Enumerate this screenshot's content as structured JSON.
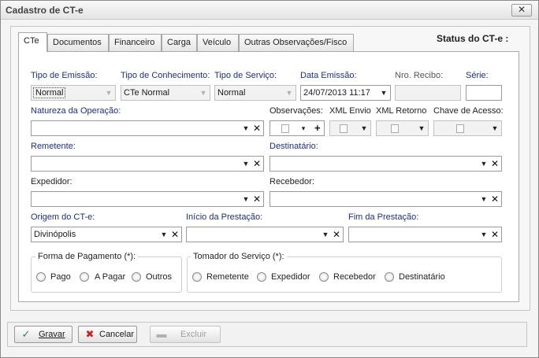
{
  "window": {
    "title": "Cadastro de CT-e"
  },
  "tabs": [
    "CTe",
    "Documentos",
    "Financeiro",
    "Carga",
    "Veículo",
    "Outras Observações/Fisco"
  ],
  "status": {
    "label": "Status do CT-e :"
  },
  "form": {
    "tipo_emissao": {
      "label": "Tipo de Emissão:",
      "value": "Normal"
    },
    "tipo_conhecimento": {
      "label": "Tipo de Conhecimento:",
      "value": "CTe Normal"
    },
    "tipo_servico": {
      "label": "Tipo de Serviço:",
      "value": "Normal"
    },
    "data_emissao": {
      "label": "Data Emissão:",
      "value": "24/07/2013 11:17"
    },
    "nro_recibo": {
      "label": "Nro. Recibo:",
      "value": ""
    },
    "serie": {
      "label": "Série:",
      "value": ""
    },
    "natureza": {
      "label": "Natureza da Operação:",
      "value": ""
    },
    "observacoes": {
      "label": "Observações:"
    },
    "xml_envio": {
      "label": "XML Envio"
    },
    "xml_retorno": {
      "label": "XML Retorno"
    },
    "chave_acesso": {
      "label": "Chave de Acesso:"
    },
    "remetente": {
      "label": "Remetente:",
      "value": ""
    },
    "destinatario": {
      "label": "Destinatário:",
      "value": ""
    },
    "expedidor": {
      "label": "Expedidor:",
      "value": ""
    },
    "recebedor": {
      "label": "Recebedor:",
      "value": ""
    },
    "origem": {
      "label": "Origem do CT-e:",
      "value": "Divinópolis"
    },
    "inicio": {
      "label": "Início da Prestação:",
      "value": ""
    },
    "fim": {
      "label": "Fim da Prestação:",
      "value": ""
    }
  },
  "pagamento": {
    "title": "Forma de Pagamento (*):",
    "options": [
      "Pago",
      "A Pagar",
      "Outros"
    ]
  },
  "tomador": {
    "title": "Tomador do Serviço (*):",
    "options": [
      "Remetente",
      "Expedidor",
      "Recebedor",
      "Destinatário"
    ]
  },
  "buttons": {
    "gravar": "Gravar",
    "cancelar": "Cancelar",
    "excluir": "Excluir"
  },
  "icons": {
    "close": "close-icon",
    "dropdown": "chevron-down-icon",
    "clear": "clear-x-icon",
    "document": "document-icon",
    "add": "plus-icon",
    "gravar": "check-icon",
    "cancelar": "cancel-x-icon",
    "excluir": "minus-icon"
  },
  "colors": {
    "field_label_blue": "#1a2ca0"
  }
}
